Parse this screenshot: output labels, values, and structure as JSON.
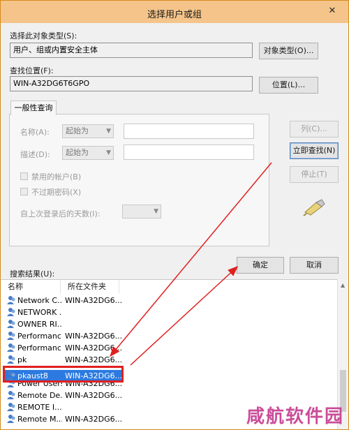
{
  "dialog": {
    "title": "选择用户或组",
    "close_glyph": "✕"
  },
  "object_type": {
    "label": "选择此对象类型(S):",
    "value": "用户、组或内置安全主体",
    "button": "对象类型(O)..."
  },
  "location": {
    "label": "查找位置(F):",
    "value": "WIN-A32DG6T6GPO",
    "button": "位置(L)..."
  },
  "query": {
    "tab": "一般性查询",
    "name_label": "名称(A):",
    "name_mode": "起始为",
    "desc_label": "描述(D):",
    "desc_mode": "起始为",
    "disabled_accounts": "禁用的帐户(B)",
    "no_expire_password": "不过期密码(X)",
    "days_since_logon": "自上次登录后的天数(I):"
  },
  "side_buttons": {
    "columns": "列(C)...",
    "find_now": "立即查找(N)",
    "stop": "停止(T)"
  },
  "dialog_buttons": {
    "ok": "确定",
    "cancel": "取消"
  },
  "results": {
    "label": "搜索结果(U):",
    "headers": {
      "name": "名称",
      "folder": "所在文件夹"
    },
    "rows": [
      {
        "name": "Network C...",
        "folder": "WIN-A32DG6..."
      },
      {
        "name": "NETWORK ...",
        "folder": ""
      },
      {
        "name": "OWNER RI...",
        "folder": ""
      },
      {
        "name": "Performanc...",
        "folder": "WIN-A32DG6..."
      },
      {
        "name": "Performanc...",
        "folder": "WIN-A32DG6..."
      },
      {
        "name": "pk",
        "folder": "WIN-A32DG6..."
      },
      {
        "name": "pkaust8",
        "folder": "WIN-A32DG6...",
        "selected": true
      },
      {
        "name": "Power Users",
        "folder": "WIN-A32DG6..."
      },
      {
        "name": "Remote De...",
        "folder": "WIN-A32DG6..."
      },
      {
        "name": "REMOTE I...",
        "folder": ""
      },
      {
        "name": "Remote M...",
        "folder": "WIN-A32DG6..."
      }
    ]
  },
  "watermark": "咸航软件园",
  "colors": {
    "titlebar": "#f4c48a",
    "selection": "#2c7ae0",
    "annotation": "#e02020",
    "watermark": "#c53a8e"
  }
}
